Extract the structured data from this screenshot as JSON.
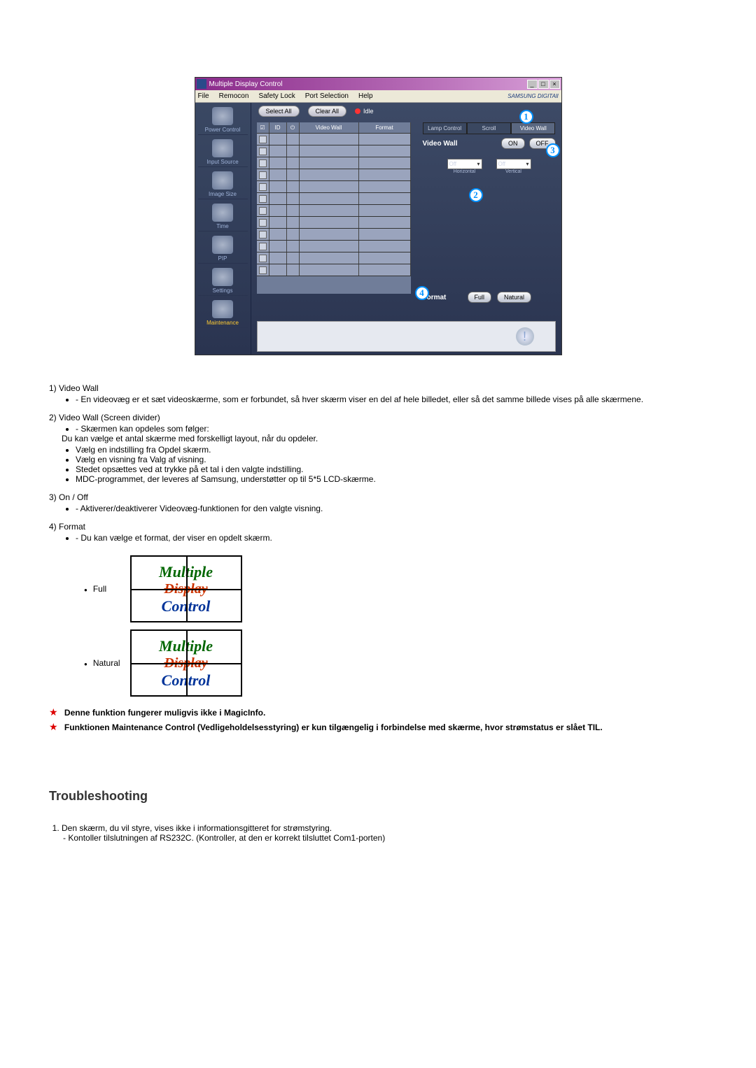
{
  "app": {
    "title": "Multiple Display Control",
    "menu": {
      "file": "File",
      "remocon": "Remocon",
      "safety": "Safety Lock",
      "port": "Port Selection",
      "help": "Help"
    },
    "brand": "SAMSUNG DIGITAll",
    "sidebar": {
      "items": [
        {
          "label": "Power Control"
        },
        {
          "label": "Input Source"
        },
        {
          "label": "Image Size"
        },
        {
          "label": "Time"
        },
        {
          "label": "PIP"
        },
        {
          "label": "Settings"
        },
        {
          "label": "Maintenance"
        }
      ]
    },
    "toolbar": {
      "selectAll": "Select All",
      "clearAll": "Clear All",
      "idle": "Idle"
    },
    "grid": {
      "headers": {
        "id": "ID",
        "videoWall": "Video Wall",
        "format": "Format"
      },
      "row_count": 12
    },
    "panel": {
      "tabs": {
        "lamp": "Lamp Control",
        "scroll": "Scroll",
        "videoWall": "Video Wall"
      },
      "videoWallLabel": "Video Wall",
      "on": "ON",
      "off": "OFF",
      "horiz": {
        "value": "Off",
        "label": "Horizontal"
      },
      "vert": {
        "value": "Off",
        "label": "Vertical"
      },
      "formatLabel": "Format",
      "full": "Full",
      "natural": "Natural"
    },
    "markers": {
      "m1": "1",
      "m2": "2",
      "m3": "3",
      "m4": "4"
    }
  },
  "doc": {
    "items": [
      {
        "num": "1)",
        "title": "Video Wall",
        "dash": "En videovæg er et sæt videoskærme, som er forbundet, så hver skærm viser en del af hele billedet, eller så det samme billede vises på alle skærmene."
      },
      {
        "num": "2)",
        "title": "Video Wall (Screen divider)",
        "dash": "Skærmen kan opdeles som følger:",
        "line2": "Du kan vælge et antal skærme med forskelligt layout, når du opdeler.",
        "bullets": [
          "Vælg en indstilling fra Opdel skærm.",
          "Vælg en visning fra Valg af visning.",
          "Stedet opsættes ved at trykke på et tal i den valgte indstilling.",
          "MDC-programmet, der leveres af Samsung, understøtter op til 5*5 LCD-skærme."
        ]
      },
      {
        "num": "3)",
        "title": "On / Off",
        "dash": "Aktiverer/deaktiverer Videovæg-funktionen for den valgte visning."
      },
      {
        "num": "4)",
        "title": "Format",
        "dash": "Du kan vælge et format, der viser en opdelt skærm."
      }
    ],
    "fmt": {
      "full": "Full",
      "natural": "Natural",
      "txt1": "Multiple",
      "txt2": "Display",
      "txt3": "Control"
    },
    "stars": [
      "Denne funktion fungerer muligvis ikke i MagicInfo.",
      "Funktionen Maintenance Control (Vedligeholdelsesstyring) er kun tilgængelig i forbindelse med skærme, hvor strømstatus er slået TIL."
    ],
    "troubleshooting": {
      "heading": "Troubleshooting",
      "item1": "Den skærm, du vil styre, vises ikke i informationsgitteret for strømstyring.",
      "item1dash": "Kontoller tilslutningen af RS232C. (Kontroller, at den er korrekt tilsluttet Com1-porten)"
    }
  }
}
